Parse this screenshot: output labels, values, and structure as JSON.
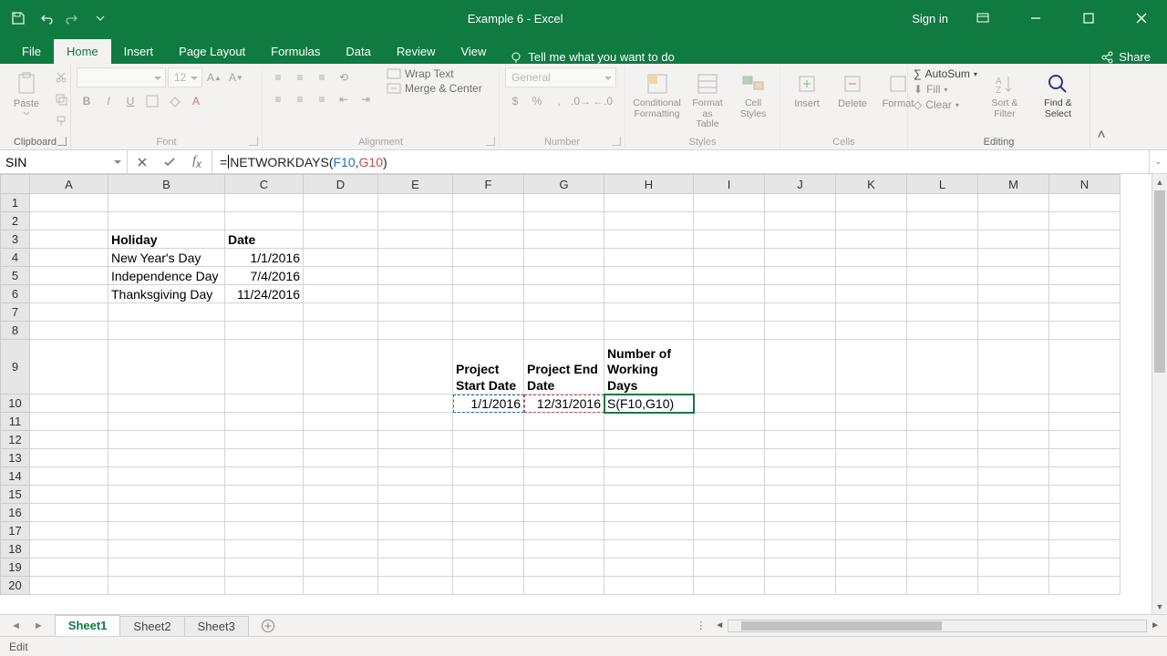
{
  "title": "Example 6  -  Excel",
  "signin": "Sign in",
  "tabs": {
    "file": "File",
    "home": "Home",
    "insert": "Insert",
    "page_layout": "Page Layout",
    "formulas": "Formulas",
    "data": "Data",
    "review": "Review",
    "view": "View"
  },
  "tellme": "Tell me what you want to do",
  "share": "Share",
  "ribbon": {
    "clipboard": {
      "label": "Clipboard",
      "paste": "Paste"
    },
    "font": {
      "label": "Font",
      "size": "12"
    },
    "alignment": {
      "label": "Alignment",
      "wrap": "Wrap Text",
      "merge": "Merge & Center"
    },
    "number": {
      "label": "Number",
      "format": "General"
    },
    "styles": {
      "label": "Styles",
      "cond": "Conditional Formatting",
      "table": "Format as Table",
      "cell": "Cell Styles"
    },
    "cells": {
      "label": "Cells",
      "insert": "Insert",
      "delete": "Delete",
      "format": "Format"
    },
    "editing": {
      "label": "Editing",
      "autosum": "AutoSum",
      "fill": "Fill",
      "clear": "Clear",
      "sort": "Sort & Filter",
      "find": "Find & Select"
    }
  },
  "name_box": "SIN",
  "formula_prefix": "=",
  "formula_func": "NETWORKDAYS(",
  "formula_arg1": "F10",
  "formula_sep": ",",
  "formula_arg2": "G10",
  "formula_suffix": ")",
  "columns": [
    "A",
    "B",
    "C",
    "D",
    "E",
    "F",
    "G",
    "H",
    "I",
    "J",
    "K",
    "L",
    "M",
    "N"
  ],
  "rows_visible": 20,
  "cells": {
    "B3": "Holiday",
    "C3": "Date",
    "B4": "New Year's Day",
    "C4": "1/1/2016",
    "B5": "Independence Day",
    "C5": "7/4/2016",
    "B6": "Thanksgiving Day",
    "C6": "11/24/2016",
    "F9": "Project Start Date",
    "G9": "Project End Date",
    "H9": "Number of Working Days",
    "F10": "1/1/2016",
    "G10": "12/31/2016",
    "H10": "S(F10,G10)"
  },
  "sheets": {
    "s1": "Sheet1",
    "s2": "Sheet2",
    "s3": "Sheet3"
  },
  "status": "Edit"
}
